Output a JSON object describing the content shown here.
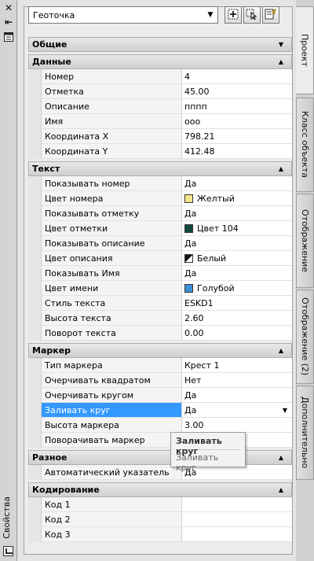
{
  "window": {
    "title": "Свойства"
  },
  "toolbar": {
    "object_type": "Геоточка"
  },
  "sections": {
    "general": {
      "label": "Общие"
    },
    "data": {
      "label": "Данные",
      "rows": [
        {
          "key": "Номер",
          "value": "4"
        },
        {
          "key": "Отметка",
          "value": "45.00"
        },
        {
          "key": "Описание",
          "value": "пппп"
        },
        {
          "key": "Имя",
          "value": "ооо"
        },
        {
          "key": "Координата X",
          "value": "798.21"
        },
        {
          "key": "Координата Y",
          "value": "412.48"
        }
      ]
    },
    "text": {
      "label": "Текст",
      "rows": [
        {
          "key": "Показывать номер",
          "value": "Да"
        },
        {
          "key": "Цвет номера",
          "value": "Желтый"
        },
        {
          "key": "Показывать отметку",
          "value": "Да"
        },
        {
          "key": "Цвет отметки",
          "value": "Цвет 104"
        },
        {
          "key": "Показывать описание",
          "value": "Да"
        },
        {
          "key": "Цвет описания",
          "value": "Белый"
        },
        {
          "key": "Показывать Имя",
          "value": "Да"
        },
        {
          "key": "Цвет имени",
          "value": "Голубой"
        },
        {
          "key": "Стиль текста",
          "value": "ESKD1"
        },
        {
          "key": "Высота текста",
          "value": "2.60"
        },
        {
          "key": "Поворот текста",
          "value": "0.00"
        }
      ]
    },
    "marker": {
      "label": "Маркер",
      "rows": [
        {
          "key": "Тип маркера",
          "value": "Крест 1"
        },
        {
          "key": "Очерчивать квадратом",
          "value": "Нет"
        },
        {
          "key": "Очерчивать кругом",
          "value": "Да"
        },
        {
          "key": "Заливать круг",
          "value": "Да"
        },
        {
          "key": "Высота маркера",
          "value": "3.00"
        },
        {
          "key": "Поворачивать маркер",
          "value": ""
        }
      ]
    },
    "misc": {
      "label": "Разное",
      "rows": [
        {
          "key": "Автоматический указатель",
          "value": "Да"
        }
      ]
    },
    "coding": {
      "label": "Кодирование",
      "rows": [
        {
          "key": "Код 1",
          "value": ""
        },
        {
          "key": "Код 2",
          "value": ""
        },
        {
          "key": "Код 3",
          "value": ""
        }
      ]
    }
  },
  "tooltip": {
    "title": "Заливать круг",
    "description": "Заливать круг"
  },
  "tabs": [
    "Проект",
    "Класс объекта",
    "Отображение",
    "Отображение (2)",
    "Дополнительно"
  ],
  "colors": {
    "selection": "#3399ff",
    "swatch_yellow": "#f5e38a",
    "swatch_104": "#0f4a3a",
    "swatch_blue": "#3b8fd9"
  },
  "icons": {
    "close": "close-icon",
    "autohide": "autohide-icon",
    "menu": "properties-menu-icon",
    "settings": "settings-icon",
    "select_add": "toggle-pickadd-icon",
    "select_objects": "select-objects-icon",
    "quick_select": "quick-select-icon"
  }
}
